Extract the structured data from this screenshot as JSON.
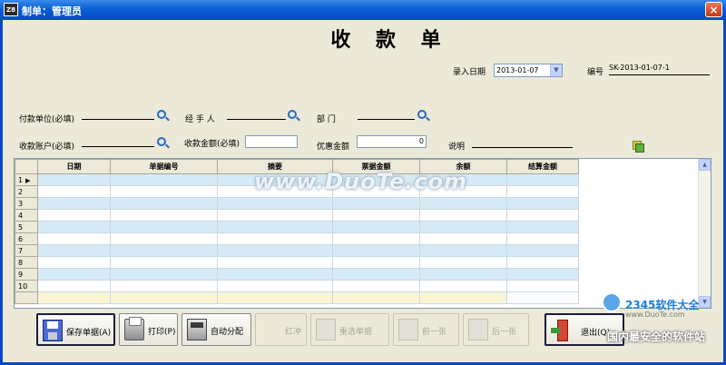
{
  "window": {
    "app_icon": "Z8",
    "title": "制单：管理员",
    "close_label": "×"
  },
  "form": {
    "title": "收 款 单",
    "entry_date_label": "录入日期",
    "entry_date_value": "2013-01-07",
    "doc_no_label": "编号",
    "doc_no_value": "SK-2013-01-07-1",
    "payer_label": "付款单位(必填)",
    "payer_value": "",
    "handler_label": "经 手 人",
    "handler_value": "",
    "department_label": "部    门",
    "department_value": "",
    "account_label": "收款账户(必填)",
    "account_value": "",
    "amount_label": "收款金额(必填)",
    "amount_value": "",
    "discount_label": "优惠金额",
    "discount_value": "0",
    "note_label": "说明",
    "note_value": ""
  },
  "grid": {
    "columns": [
      "日期",
      "单据编号",
      "摘要",
      "票据金额",
      "余额",
      "结算金额"
    ],
    "row_numbers": [
      "1",
      "2",
      "3",
      "4",
      "5",
      "6",
      "7",
      "8",
      "9",
      "10",
      ""
    ],
    "current_row_marker": "▶"
  },
  "toolbar": {
    "save_label": "保存单据(A)",
    "print_label": "打印(P)",
    "auto_assign_label": "自动分配",
    "red_reverse_label": "红冲",
    "reselect_label": "重选单据",
    "prev_label": "前一张",
    "next_label": "后一张",
    "exit_label": "退出(Q)"
  },
  "overlays": {
    "watermark": "www.DuoTe.com",
    "corner_brand": "2345软件大全",
    "corner_url": "www.DuoTe.com",
    "corner_slogan": "国内最安全的软件站"
  },
  "icons": [
    "app-icon",
    "close-icon",
    "lookup-icon",
    "calendar-dropdown-icon",
    "copy-icon",
    "save-icon",
    "print-icon",
    "auto-assign-icon",
    "red-reverse-icon",
    "reselect-icon",
    "prev-icon",
    "next-icon",
    "exit-icon"
  ]
}
